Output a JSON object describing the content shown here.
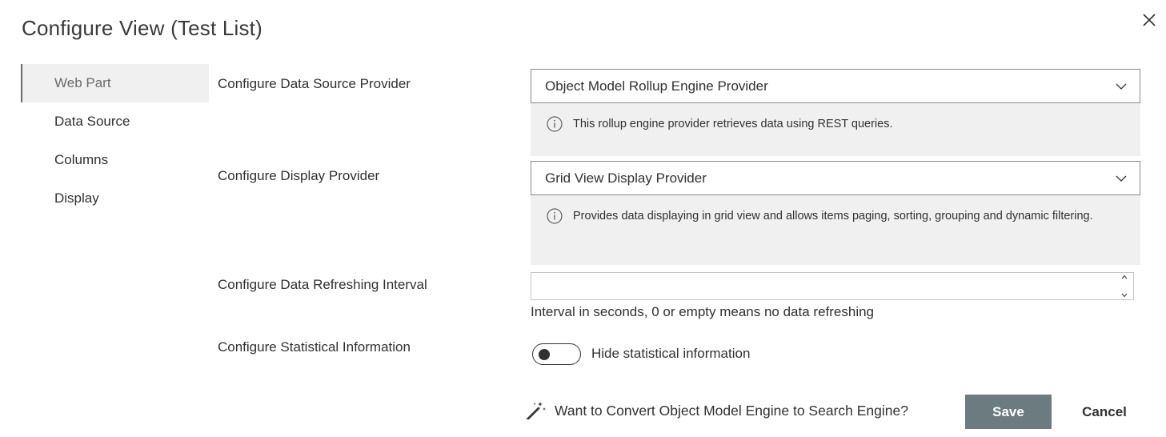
{
  "dialog": {
    "title": "Configure View (Test List)"
  },
  "nav": {
    "items": [
      {
        "label": "Web Part",
        "active": true
      },
      {
        "label": "Data Source",
        "active": false
      },
      {
        "label": "Columns",
        "active": false
      },
      {
        "label": "Display",
        "active": false
      }
    ]
  },
  "form": {
    "data_source_provider": {
      "label": "Configure Data Source Provider",
      "selected": "Object Model Rollup Engine Provider",
      "info": "This rollup engine provider retrieves data using REST queries."
    },
    "display_provider": {
      "label": "Configure Display Provider",
      "selected": "Grid View Display Provider",
      "info": "Provides data displaying in grid view and allows items paging, sorting, grouping and dynamic filtering."
    },
    "refresh_interval": {
      "label": "Configure Data Refreshing Interval",
      "value": "",
      "hint": "Interval in seconds, 0 or empty means no data refreshing"
    },
    "statistical_info": {
      "label": "Configure Statistical Information",
      "toggle_on": false,
      "toggle_label": "Hide statistical information"
    }
  },
  "footer": {
    "convert_link": "Want to Convert Object Model Engine to Search Engine?",
    "save_label": "Save",
    "cancel_label": "Cancel"
  },
  "icons": {
    "close": "close-icon",
    "chevron": "chevron-down-icon",
    "info": "info-icon",
    "wand": "magic-wand-icon"
  },
  "colors": {
    "save_button": "#6b7b80",
    "info_panel": "#f0f0f0",
    "nav_active": "#f0f0f0"
  }
}
